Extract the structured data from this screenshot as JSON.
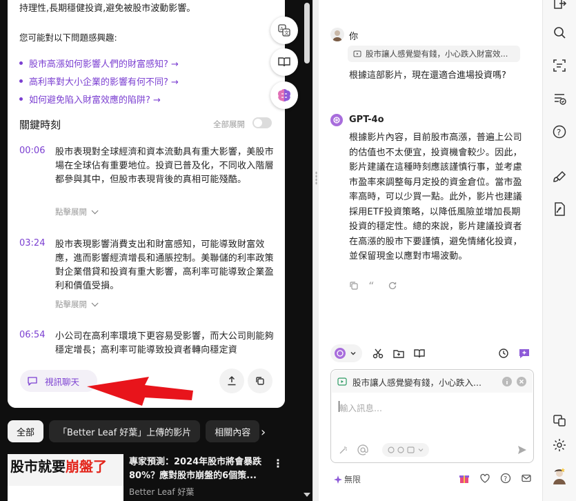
{
  "summary": {
    "intro_tail": "持理性,長期穩健投資,避免被股市波動影響。",
    "interest_label": "您可能對以下問題感興趣:",
    "questions": [
      "股市高漲如何影響人們的財富感知? →",
      "高利率對大小企業的影響有何不同? →",
      "如何避免陷入財富效應的陷阱? →"
    ],
    "key_moments_title": "關鍵時刻",
    "expand_all_label": "全部展開",
    "expand_all_on": false,
    "moments": [
      {
        "time": "00:06",
        "text": "股市表現對全球經濟和資本流動具有重大影響，美股市場在全球佔有重要地位。投資已普及化，不同收入階層都參與其中，但股市表現背後的真相可能殘酷。",
        "more": "點擊展開"
      },
      {
        "time": "03:24",
        "text": "股市表現影響消費支出和財富感知，可能導致財富效應，進而影響經濟增長和通脹控制。美聯儲的利率政策對企業借貸和投資有重大影響，高利率可能導致企業盈利和價值受損。",
        "more": "點擊展開"
      },
      {
        "time": "06:54",
        "text": "小公司在高利率環境下更容易受影響，而大公司則能夠穩定增長；高利率可能導致投資者轉向穩定資",
        "more": ""
      }
    ],
    "video_chat_label": "視訊聊天"
  },
  "chips": [
    "全部",
    "「Better Leaf 好葉」上傳的影片",
    "相關內容"
  ],
  "video": {
    "thumb_text_a": "股市就要",
    "thumb_text_b": "崩盤了",
    "title": "專家預測：2024年股市將會暴跌80%？應對股市崩盤的6個策...",
    "channel": "Better Leaf 好葉"
  },
  "chat": {
    "user_name": "你",
    "attachment": "股市讓人感覺變有錢，小心跌入財富效...",
    "user_message": "根據這部影片，現在還適合進場投資嗎?",
    "bot_name": "GPT-4o",
    "bot_message": "根據影片內容，目前股市高漲，普遍上公司的估值也不太便宜，投資機會較少。因此，影片建議在這種時刻應該謹慎行事，並考慮市盈率來調整每月定投的資金倉位。當市盈率高時，可以少買一點。此外，影片也建議採用ETF投資策略，以降低風險並增加長期投資的穩定性。總的來說，影片建議投資者在高漲的股市下要謹慎，避免情緒化投資，並保留現金以應對市場波動。",
    "input_attachment": "股市讓人感覺變有錢，小心跌入...",
    "input_placeholder": "輸入訊息...",
    "plan_label": "無限"
  },
  "colors": {
    "accent": "#7b3fd1",
    "arrow": "#e8141b",
    "bot_avatar": "#a86ddc"
  }
}
